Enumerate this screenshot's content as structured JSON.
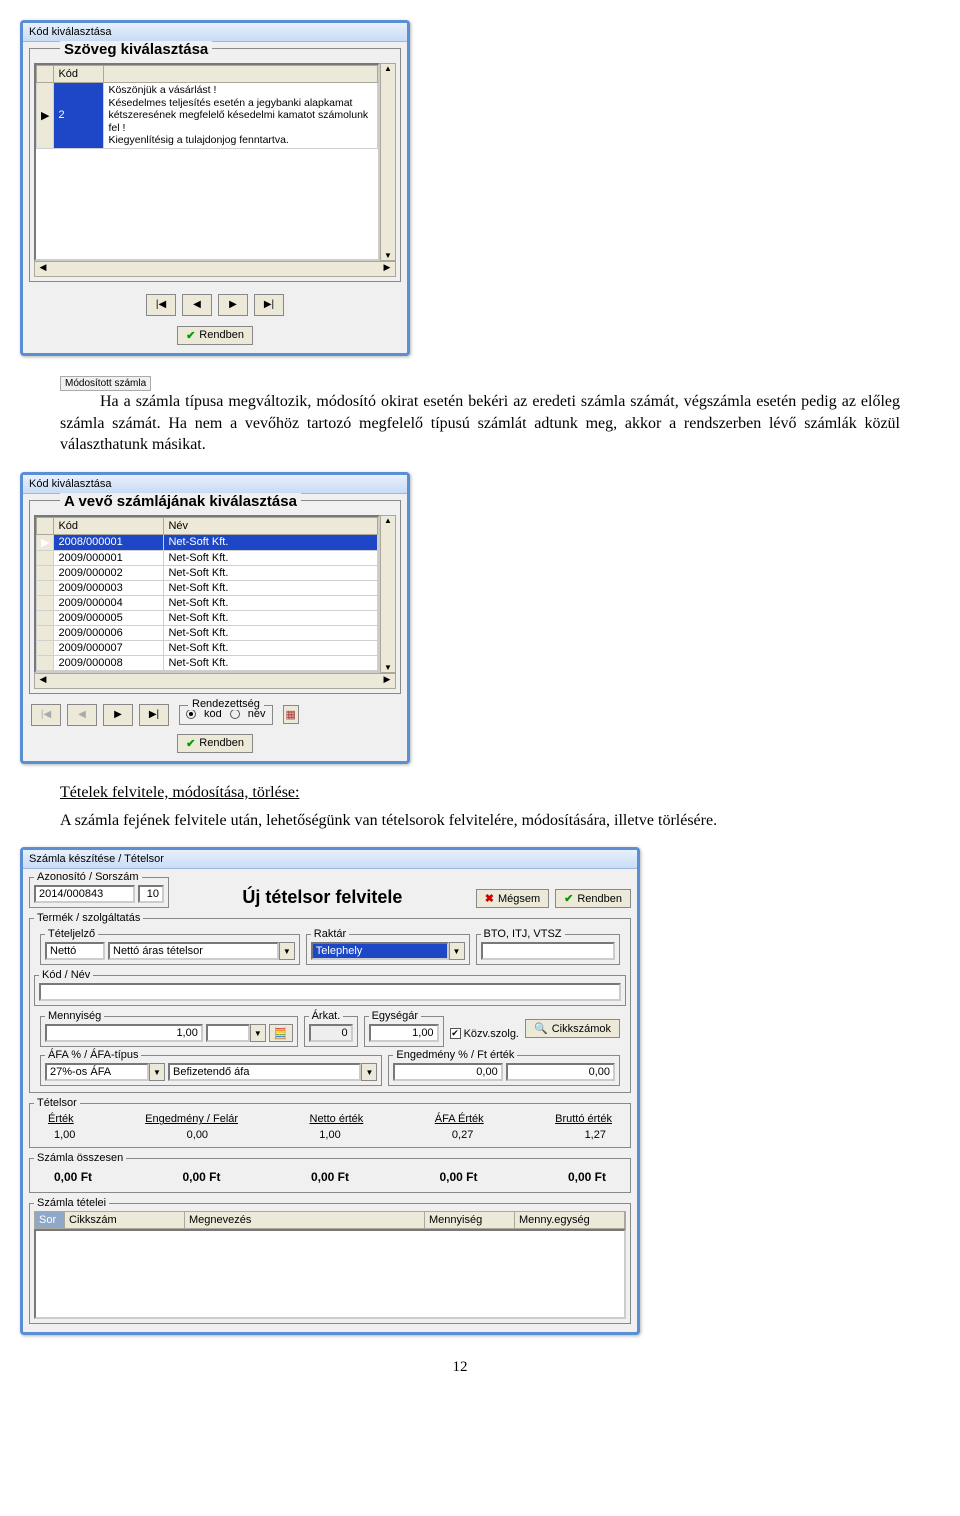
{
  "win1": {
    "title": "Kód kiválasztása",
    "panel_title": "Szöveg kiválasztása",
    "cols": {
      "c1": "Kód",
      "c2": ""
    },
    "rows": [
      {
        "kod": "2",
        "text": "Köszönjük a vásárlást !\nKésedelmes teljesítés esetén a jegybanki alapkamat kétszeresének megfelelő késedelmi kamatot számolunk fel !\nKiegyenlítésig a tulajdonjog fenntartva."
      }
    ],
    "ok": "Rendben"
  },
  "mod_label": "Módosított számla",
  "para1": "Ha a számla típusa megváltozik, módosító okirat esetén bekéri az eredeti számla számát, végszámla esetén pedig az előleg számla számát. Ha nem a vevőhöz tartozó megfelelő típusú számlát adtunk meg, akkor a rendszerben lévő számlák közül választhatunk másikat.",
  "win2": {
    "title": "Kód kiválasztása",
    "panel_title": "A vevő számlájának kiválasztása",
    "cols": {
      "c1": "Kód",
      "c2": "Név"
    },
    "rows": [
      {
        "kod": "2008/000001",
        "nev": "Net-Soft Kft.",
        "sel": true
      },
      {
        "kod": "2009/000001",
        "nev": "Net-Soft Kft."
      },
      {
        "kod": "2009/000002",
        "nev": "Net-Soft Kft."
      },
      {
        "kod": "2009/000003",
        "nev": "Net-Soft Kft."
      },
      {
        "kod": "2009/000004",
        "nev": "Net-Soft Kft."
      },
      {
        "kod": "2009/000005",
        "nev": "Net-Soft Kft."
      },
      {
        "kod": "2009/000006",
        "nev": "Net-Soft Kft."
      },
      {
        "kod": "2009/000007",
        "nev": "Net-Soft Kft."
      },
      {
        "kod": "2009/000008",
        "nev": "Net-Soft Kft."
      }
    ],
    "sort_label": "Rendezettség",
    "sort_kod": "kód",
    "sort_nev": "név",
    "ok": "Rendben"
  },
  "section_title": "Tételek felvitele, módosítása, törlése:",
  "para2": "A számla fejének felvitele után, lehetőségünk van tételsorok felvitelére, módosítására, illetve törlésére.",
  "win3": {
    "title": "Számla készítése / Tételsor",
    "azon_label": "Azonosító / Sorszám",
    "azon_val": "2014/000843",
    "sor_val": "10",
    "head": "Új tételsor felvitele",
    "cancel": "Mégsem",
    "ok": "Rendben",
    "group_termek": "Termék / szolgáltatás",
    "tjel_label": "Tételjelző",
    "tjel_val": "Nettó",
    "tjel2_val": "Nettó áras tételsor",
    "raktar_label": "Raktár",
    "raktar_val": "Telephely",
    "bto_label": "BTO, ITJ, VTSZ",
    "kodnev_label": "Kód / Név",
    "menny_label": "Mennyiség",
    "menny_val": "1,00",
    "arkat_label": "Árkat.",
    "arkat_val": "0",
    "egysegar_label": "Egységár",
    "egysegar_val": "1,00",
    "kozv_label": "Közv.szolg.",
    "cikksz_btn": "Cikkszámok",
    "afa_label": "ÁFA % / ÁFA-típus",
    "afa_val": "27%-os ÁFA",
    "afa2_val": "Befizetendő áfa",
    "enged_label": "Engedmény % / Ft érték",
    "enged_v1": "0,00",
    "enged_v2": "0,00",
    "tetelsor_label": "Tételsor",
    "cols": {
      "c1": "Érték",
      "c2": "Engedmény / Felár",
      "c3": "Netto érték",
      "c4": "ÁFA Érték",
      "c5": "Bruttó érték"
    },
    "vals": {
      "v1": "1,00",
      "v2": "0,00",
      "v3": "1,00",
      "v4": "0,27",
      "v5": "1,27"
    },
    "osszesen_label": "Számla összesen",
    "tot": {
      "t1": "0,00 Ft",
      "t2": "0,00 Ft",
      "t3": "0,00 Ft",
      "t4": "0,00 Ft",
      "t5": "0,00 Ft"
    },
    "tetelei_label": "Számla tételei",
    "tbl": {
      "c1": "Sor",
      "c2": "Cikkszám",
      "c3": "Megnevezés",
      "c4": "Mennyiség",
      "c5": "Menny.egység"
    }
  },
  "page": "12"
}
